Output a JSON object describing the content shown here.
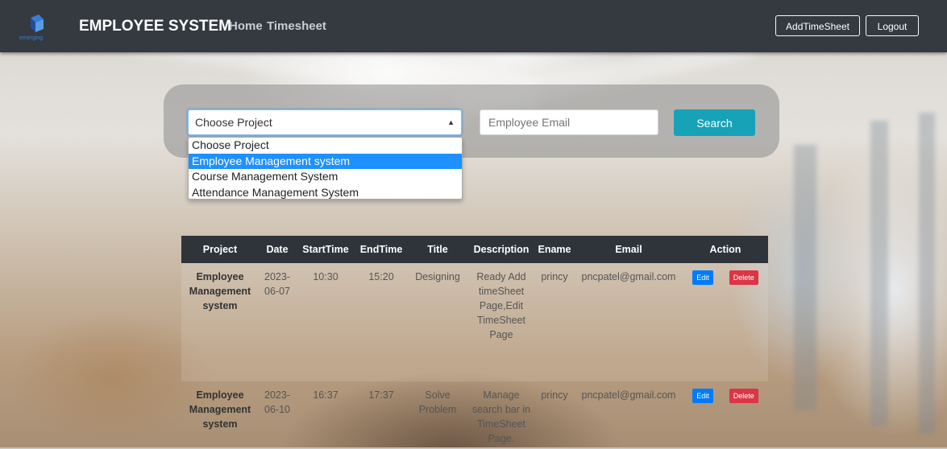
{
  "navbar": {
    "logo_text": "emerging",
    "brand": "EMPLOYEE SYSTEM",
    "links": [
      "Home",
      "Timesheet"
    ],
    "add_button": "AddTimeSheet",
    "logout_button": "Logout"
  },
  "search": {
    "project_select_value": "Choose Project",
    "project_options": [
      "Choose Project",
      "Employee Management system",
      "Course Management System",
      "Attendance Management System"
    ],
    "highlighted_option": "Employee Management system",
    "email_placeholder": "Employee Email",
    "search_button": "Search"
  },
  "table": {
    "headers": [
      "Project",
      "Date",
      "StartTime",
      "EndTime",
      "Title",
      "Description",
      "Ename",
      "Email",
      "Action"
    ],
    "rows": [
      {
        "project": "Employee Management system",
        "date": "2023-06-07",
        "start": "10:30",
        "end": "15:20",
        "title": "Designing",
        "description": "Ready Add timeSheet Page,Edit TimeSheet Page",
        "ename": "princy",
        "email": "pncpatel@gmail.com",
        "edit": "Edit",
        "delete": "Delete"
      },
      {
        "project": "Employee Management system",
        "date": "2023-06-10",
        "start": "16:37",
        "end": "17:37",
        "title": "Solve Problem",
        "description": "Manage search bar in TimeSheet Page.",
        "ename": "princy",
        "email": "pncpatel@gmail.com",
        "edit": "Edit",
        "delete": "Delete"
      }
    ]
  },
  "colors": {
    "navbar": "#343a40",
    "search_button": "#17a2b8",
    "edit_button": "#007bff",
    "delete_button": "#dc3545",
    "highlight": "#1e90ff"
  }
}
